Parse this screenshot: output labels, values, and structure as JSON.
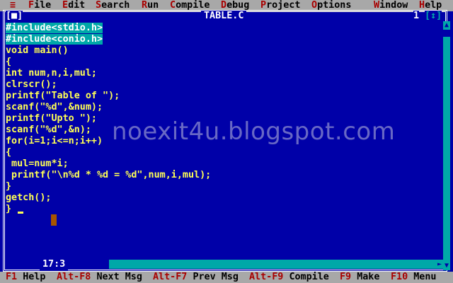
{
  "menu": {
    "system": "≡",
    "items": [
      {
        "hk": "F",
        "rest": "ile"
      },
      {
        "hk": "E",
        "rest": "dit"
      },
      {
        "hk": "S",
        "rest": "earch"
      },
      {
        "hk": "R",
        "rest": "un"
      },
      {
        "hk": "C",
        "rest": "ompile"
      },
      {
        "hk": "D",
        "rest": "ebug"
      },
      {
        "hk": "P",
        "rest": "roject"
      },
      {
        "hk": "O",
        "rest": "ptions"
      },
      {
        "hk": "W",
        "rest": "indow"
      },
      {
        "hk": "H",
        "rest": "elp"
      }
    ]
  },
  "window": {
    "close_box": "[■]",
    "title": "TABLE.C",
    "number": "1",
    "zoom_box": "[↕]",
    "position": "17:3"
  },
  "code": {
    "lines": [
      "#include<stdio.h>",
      "#include<conio.h>",
      "void main()",
      "{",
      "int num,n,i,mul;",
      "clrscr();",
      "printf(\"Table of \");",
      "scanf(\"%d\",&num);",
      "printf(\"Upto \");",
      "scanf(\"%d\",&n);",
      "for(i=1;i<=n;i++)",
      "{",
      " mul=num*i;",
      " printf(\"\\n%d * %d = %d\",num,i,mul);",
      "}",
      "getch();",
      "}"
    ]
  },
  "watermark": "noexit4u.blogspot.com",
  "status": {
    "items": [
      {
        "key": "F1",
        "label": "Help"
      },
      {
        "key": "Alt-F8",
        "label": "Next Msg"
      },
      {
        "key": "Alt-F7",
        "label": "Prev Msg"
      },
      {
        "key": "Alt-F9",
        "label": "Compile"
      },
      {
        "key": "F9",
        "label": "Make"
      },
      {
        "key": "F10",
        "label": "Menu"
      }
    ]
  },
  "colors": {
    "background": "#0000a8",
    "text": "#ffff54",
    "string": "#a80000",
    "hotkey": "#a80000",
    "bar": "#a8a8a8",
    "highlight": "#00a8a8"
  }
}
